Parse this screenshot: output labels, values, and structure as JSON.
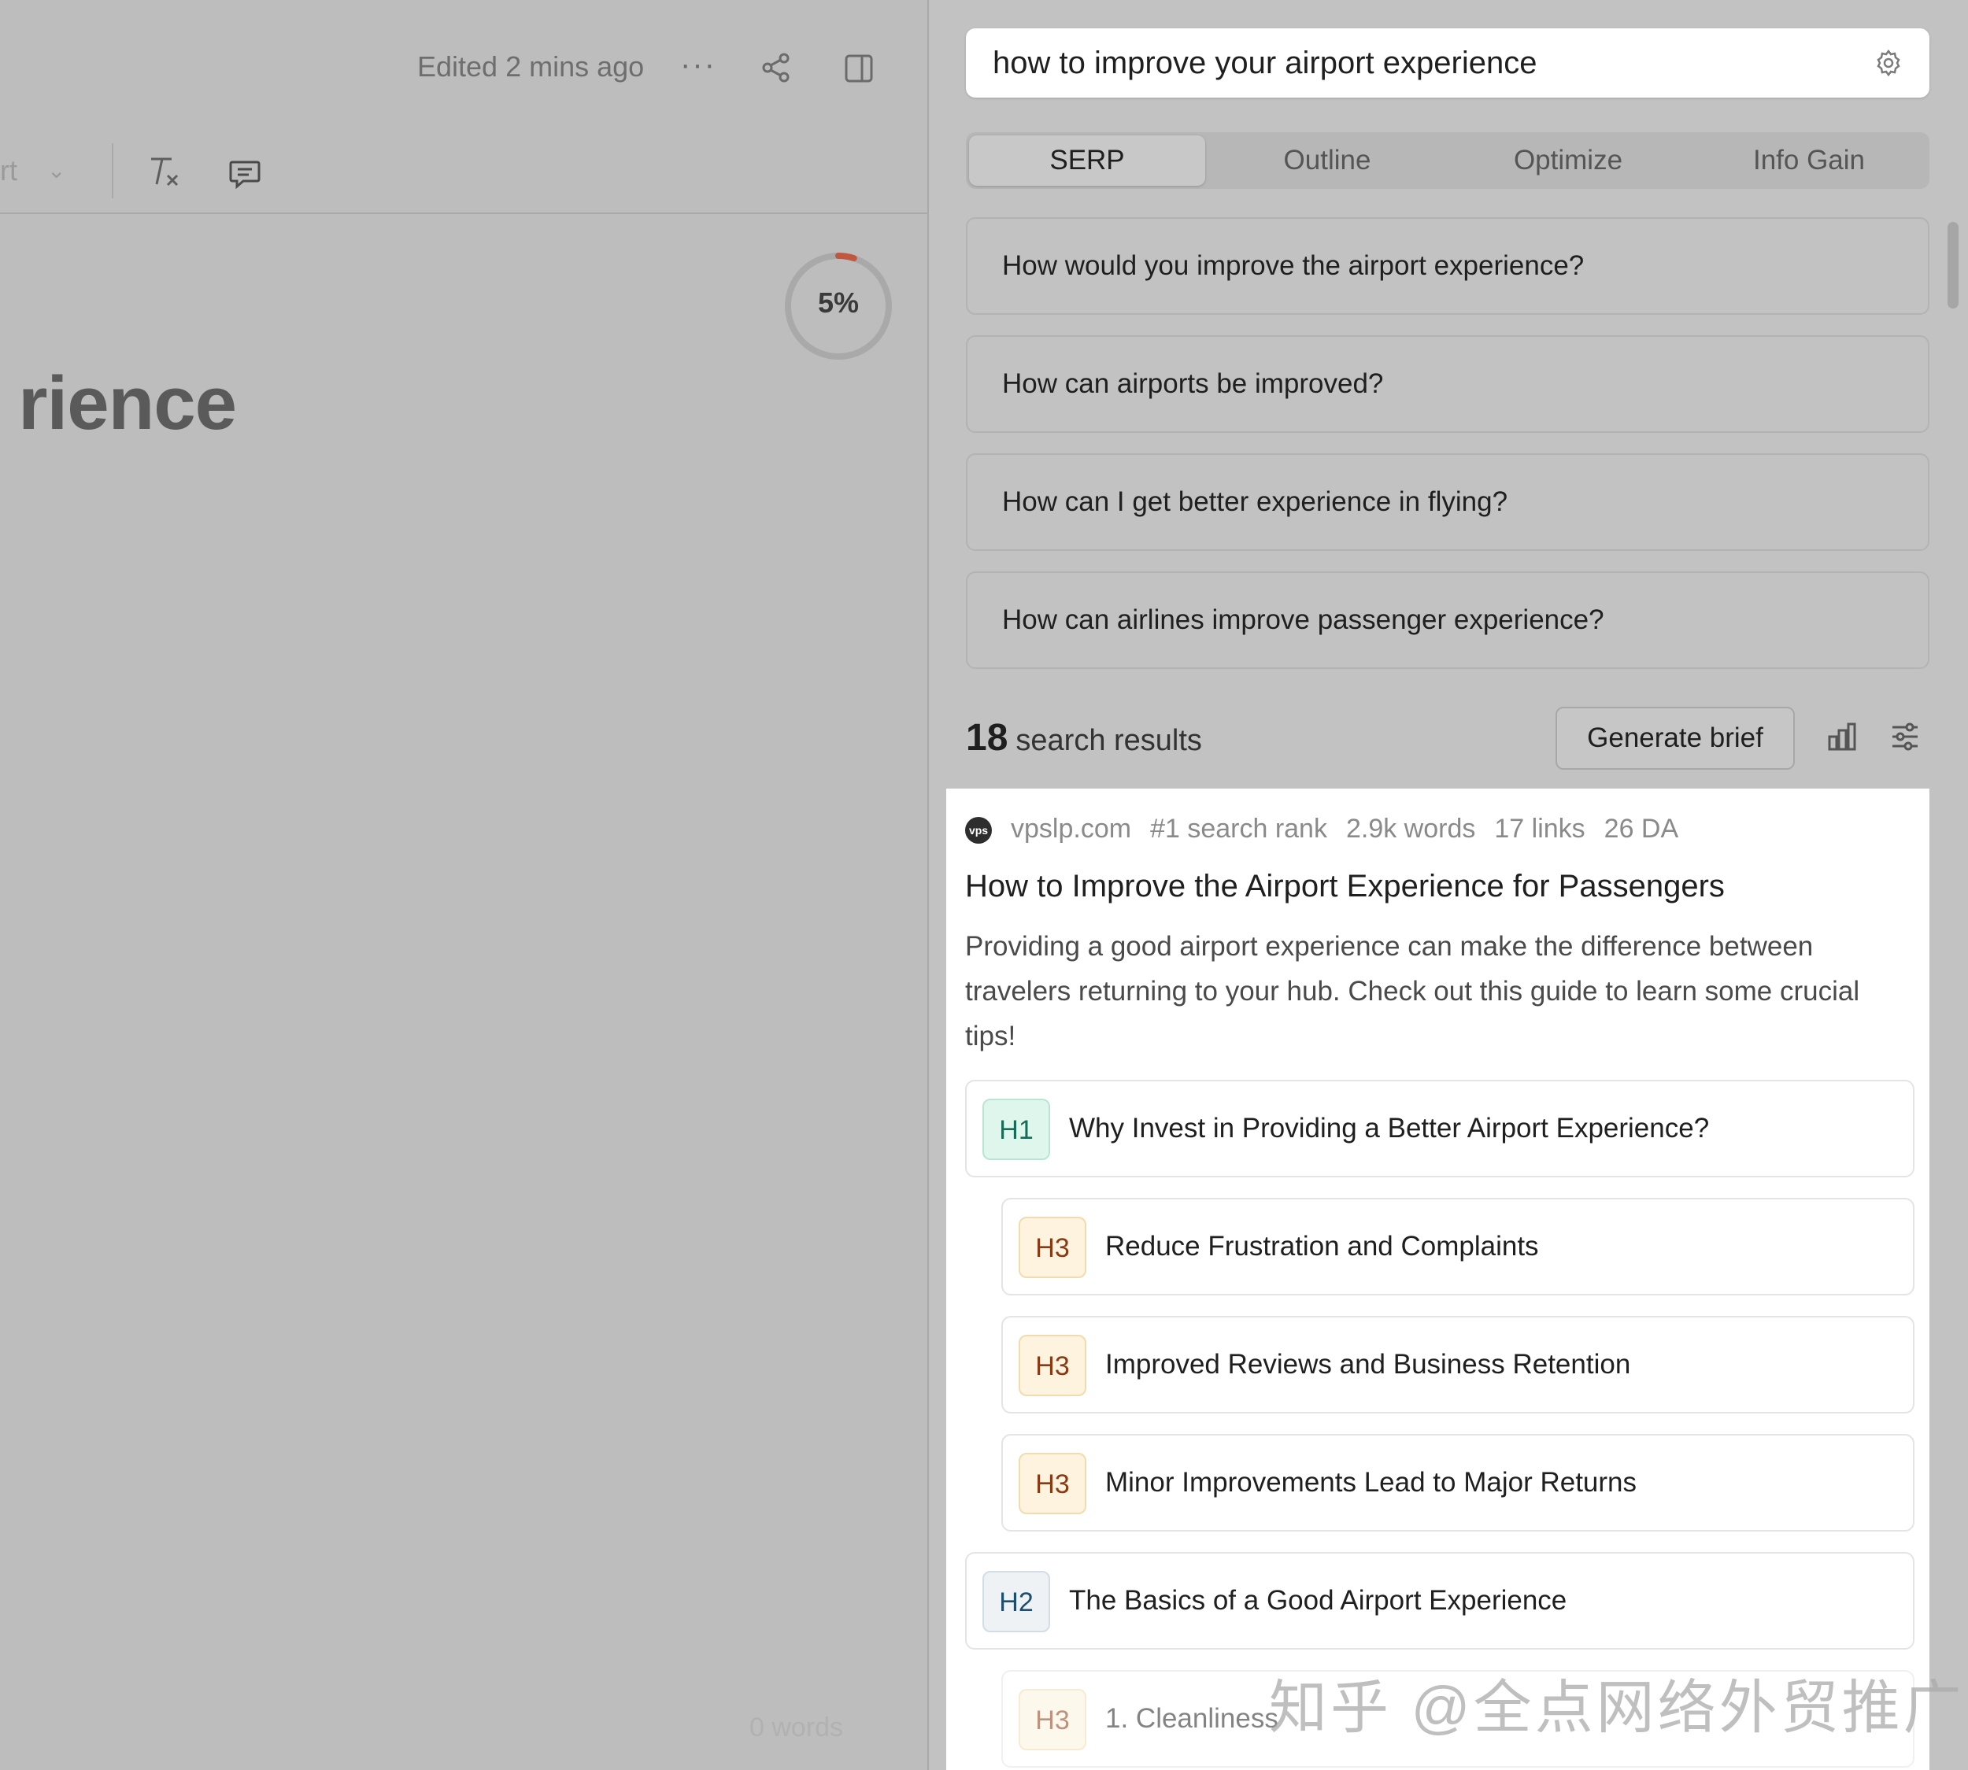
{
  "editor": {
    "edited_label": "Edited 2 mins ago",
    "more_label": "···",
    "format_fragment": "rt",
    "progress_percent": 5,
    "progress_label": "5%",
    "title_fragment": "rience",
    "word_count": "0 words",
    "colors": {
      "progress_accent": "#c2573f"
    }
  },
  "panel": {
    "search_query": "how to improve your airport experience",
    "tabs": [
      {
        "label": "SERP",
        "active": true
      },
      {
        "label": "Outline",
        "active": false
      },
      {
        "label": "Optimize",
        "active": false
      },
      {
        "label": "Info Gain",
        "active": false
      }
    ],
    "questions": [
      "How would you improve the airport experience?",
      "How can airports be improved?",
      "How can I get better experience in flying?",
      "How can airlines improve passenger experience?"
    ],
    "results_count": "18",
    "results_label": "search results",
    "generate_brief_label": "Generate brief",
    "result": {
      "favicon_text": "vps",
      "domain": "vpslp.com",
      "rank": "#1 search rank",
      "words": "2.9k words",
      "links": "17 links",
      "da": "26 DA",
      "title": "How to Improve the Airport Experience for Passengers",
      "description": "Providing a good airport experience can make the difference between travelers returning to your hub. Check out this guide to learn some crucial tips!",
      "headings": [
        {
          "level": "H1",
          "text": "Why Invest in Providing a Better Airport Experience?"
        },
        {
          "level": "H3",
          "text": "Reduce Frustration and Complaints"
        },
        {
          "level": "H3",
          "text": "Improved Reviews and Business Retention"
        },
        {
          "level": "H3",
          "text": "Minor Improvements Lead to Major Returns"
        },
        {
          "level": "H2",
          "text": "The Basics of a Good Airport Experience"
        },
        {
          "level": "H3",
          "text": "1. Cleanliness"
        }
      ]
    }
  },
  "watermark": "知乎 @全点网络外贸推广"
}
